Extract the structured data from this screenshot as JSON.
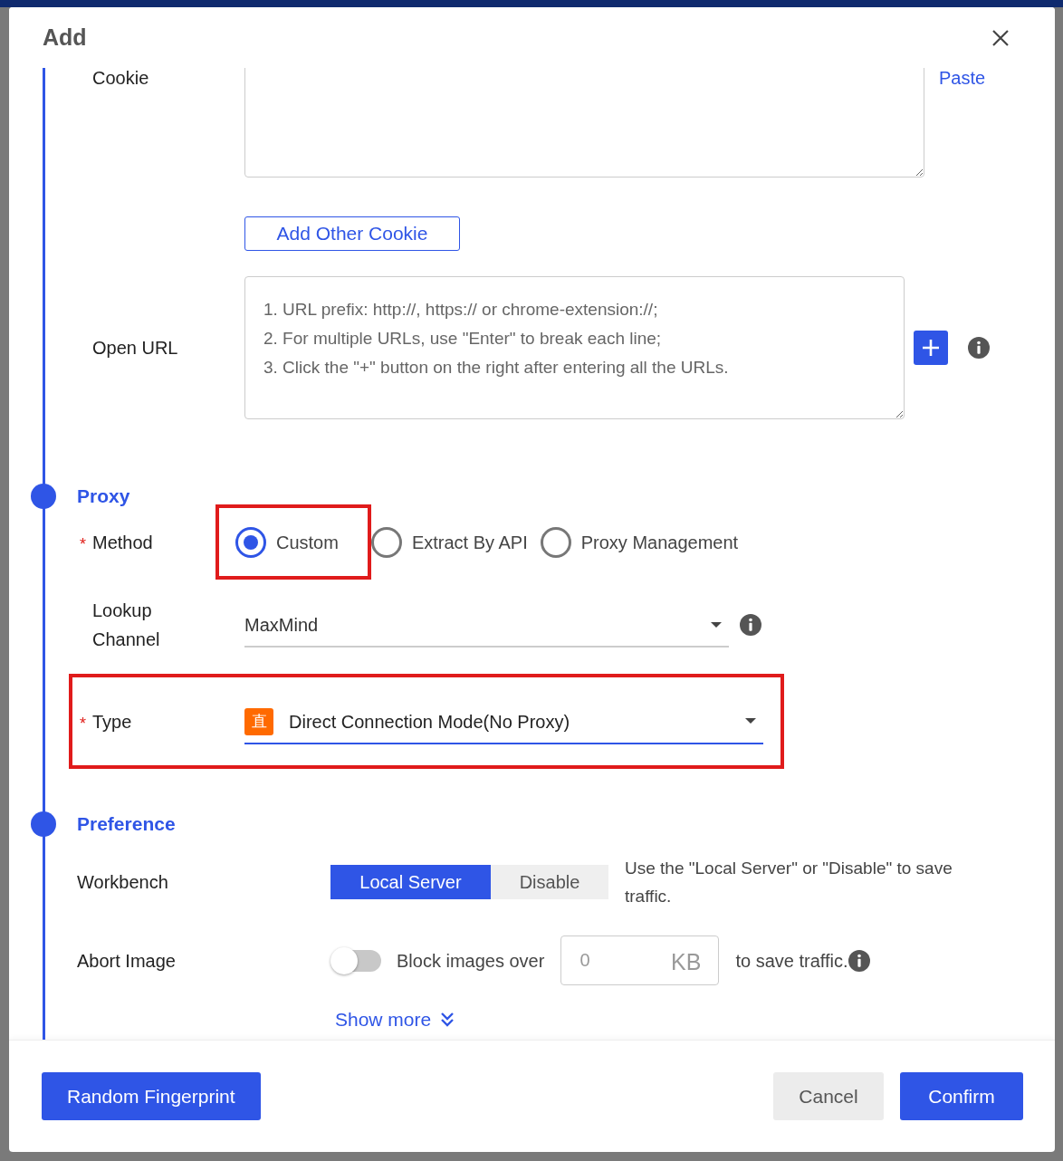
{
  "dialog": {
    "title": "Add"
  },
  "cookie": {
    "label": "Cookie",
    "paste_link": "Paste",
    "add_button": "Add Other Cookie"
  },
  "open_url": {
    "label": "Open URL",
    "placeholder": "1. URL prefix: http://, https:// or chrome-extension://;\n2. For multiple URLs, use \"Enter\" to break each line;\n3. Click the \"+\" button on the right after entering all the URLs."
  },
  "proxy": {
    "heading": "Proxy",
    "method": {
      "label": "Method",
      "required_mark": "*",
      "options": [
        {
          "label": "Custom",
          "selected": true,
          "highlighted": true
        },
        {
          "label": "Extract By API",
          "selected": false,
          "highlighted": false
        },
        {
          "label": "Proxy Management",
          "selected": false,
          "highlighted": false
        }
      ]
    },
    "lookup_channel": {
      "label": "Lookup Channel",
      "value": "MaxMind"
    },
    "type": {
      "label": "Type",
      "required_mark": "*",
      "highlighted": true,
      "badge": "直",
      "value": "Direct Connection Mode(No Proxy)"
    }
  },
  "preference": {
    "heading": "Preference",
    "workbench": {
      "label": "Workbench",
      "options": [
        {
          "label": "Local Server",
          "selected": true
        },
        {
          "label": "Disable",
          "selected": false
        }
      ],
      "hint": "Use the \"Local Server\" or \"Disable\" to save traffic."
    },
    "abort_image": {
      "label": "Abort Image",
      "on": false,
      "prefix": "Block images over",
      "placeholder": "0",
      "unit": "KB",
      "suffix": "to save traffic."
    },
    "show_more": "Show more"
  },
  "footer": {
    "random_button": "Random Fingerprint",
    "cancel_button": "Cancel",
    "confirm_button": "Confirm"
  }
}
